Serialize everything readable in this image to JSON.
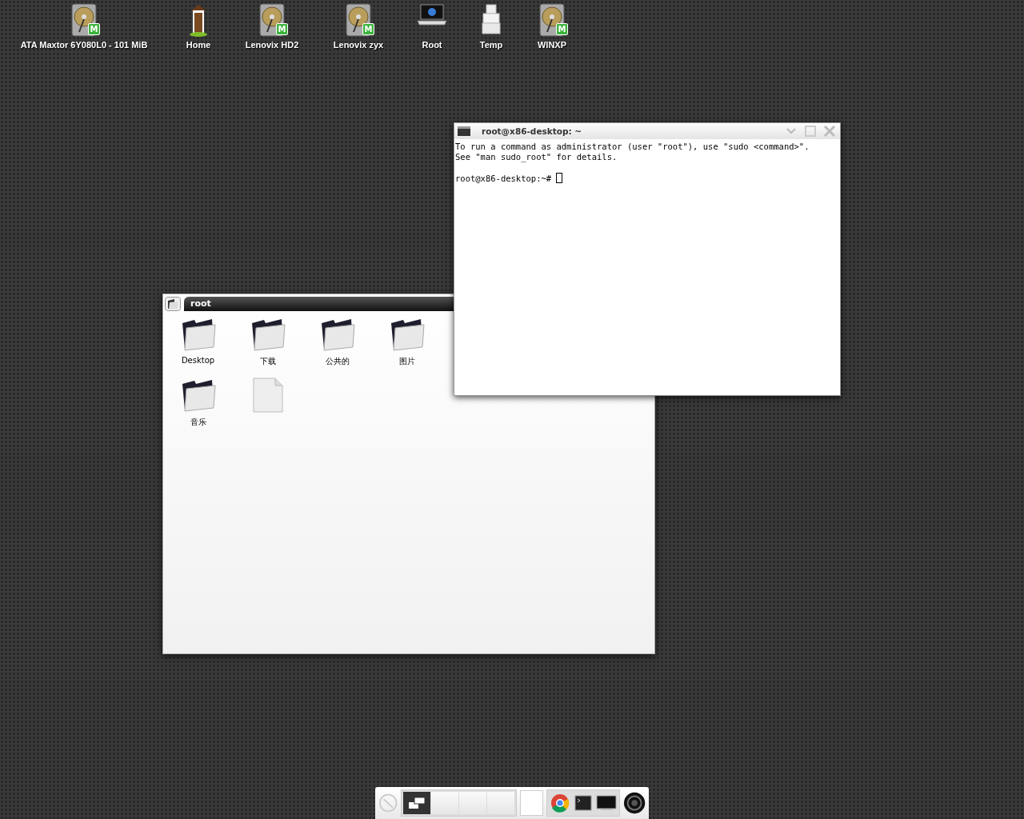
{
  "desktop_icons": [
    {
      "label": "ATA Maxtor 6Y080L0 - 101 MiB",
      "kind": "drive",
      "badge": "M"
    },
    {
      "label": "Home",
      "kind": "home"
    },
    {
      "label": "Lenovix HD2",
      "kind": "drive",
      "badge": "M"
    },
    {
      "label": "Lenovix zyx",
      "kind": "drive",
      "badge": "M"
    },
    {
      "label": "Root",
      "kind": "computer"
    },
    {
      "label": "Temp",
      "kind": "boxes"
    },
    {
      "label": "WINXP",
      "kind": "drive",
      "badge": "M"
    }
  ],
  "file_manager": {
    "title": "root",
    "items": [
      {
        "label": "Desktop",
        "kind": "folder"
      },
      {
        "label": "下载",
        "kind": "folder"
      },
      {
        "label": "公共的",
        "kind": "folder"
      },
      {
        "label": "图片",
        "kind": "folder"
      },
      {
        "label": "音乐",
        "kind": "folder"
      },
      {
        "kind": "file"
      }
    ]
  },
  "terminal": {
    "title": "root@x86-desktop: ~",
    "output": [
      "To run a command as administrator (user \"root\"), use \"sudo <command>\".",
      "See \"man sudo_root\" for details."
    ],
    "prompt": "root@x86-desktop:~# "
  },
  "taskbar": {
    "workspaces": [
      {
        "selected": true
      },
      {
        "selected": false
      },
      {
        "selected": false
      },
      {
        "selected": false
      }
    ],
    "launchers": [
      {
        "kind": "browser"
      },
      {
        "kind": "terminal"
      },
      {
        "kind": "display"
      }
    ]
  }
}
